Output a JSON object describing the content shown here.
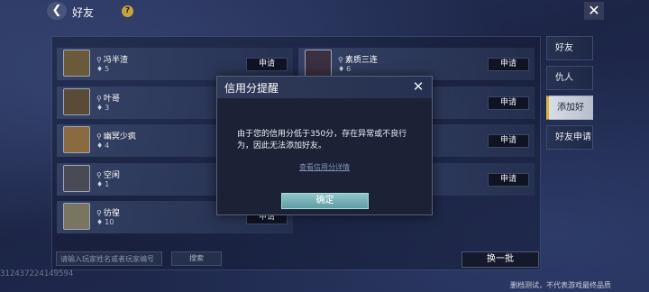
{
  "header": {
    "back_icon": "chevron-left-icon",
    "title": "好友",
    "help_label": "?",
    "close_icon": "close-icon"
  },
  "friends_left": [
    {
      "name": "冯半渣",
      "count": "5",
      "apply": "申请",
      "avatar_color": "#6a5a3a"
    },
    {
      "name": "叶哥",
      "count": "3",
      "apply": "申请",
      "avatar_color": "#5a4a38"
    },
    {
      "name": "幽冥少疯",
      "count": "4",
      "apply": "申请",
      "avatar_color": "#8a6a40"
    },
    {
      "name": "空闲",
      "count": "1",
      "apply": "申请",
      "avatar_color": "#4a4a55"
    },
    {
      "name": "彷徨",
      "count": "10",
      "apply": "申请",
      "avatar_color": "#7a7560"
    }
  ],
  "friends_right": [
    {
      "name": "素质三连",
      "count": "6",
      "apply": "申请",
      "avatar_color": "#3a3040"
    },
    {
      "apply": "申请"
    },
    {
      "apply": "申请"
    },
    {
      "apply": "申请"
    }
  ],
  "tabs": [
    {
      "label": "好友",
      "active": false
    },
    {
      "label": "仇人",
      "active": false
    },
    {
      "label": "添加好友",
      "active": true
    },
    {
      "label": "好友申请",
      "active": false
    }
  ],
  "search": {
    "placeholder": "请输入玩家姓名或者玩家编号",
    "button": "搜索"
  },
  "refresh_button": "换一批",
  "player_id": "312437224149594",
  "footer_note": "删档测试，不代表游戏最终品质",
  "modal": {
    "title": "信用分提醒",
    "message": "由于您的信用分低于350分，存在异常或不良行为，因此无法添加好友。",
    "link": "查看信用分详情",
    "confirm": "确定",
    "confirm_color": "#7bb5b8"
  }
}
